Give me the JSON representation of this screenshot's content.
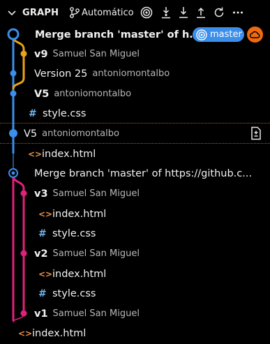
{
  "header": {
    "title": "GRAPH",
    "mode": "Automático",
    "icons": [
      "chevron-down-icon",
      "git-branch-icon",
      "target-icon",
      "fetch-icon",
      "pull-icon",
      "push-icon",
      "refresh-icon",
      "more-icon"
    ]
  },
  "commits": [
    {
      "message": "Merge branch 'master' of h...",
      "author": "",
      "bold": true,
      "badge": "master"
    },
    {
      "message": "v9",
      "author": "Samuel San Miguel",
      "bold": true
    },
    {
      "message": "Version 25",
      "author": "antoniomontalbo",
      "bold": false
    },
    {
      "message": "V5",
      "author": "antoniomontalbo",
      "bold": true
    },
    {
      "message": "V5",
      "author": "antoniomontalbo",
      "bold": false
    },
    {
      "message": "Merge branch 'master' of https://github.c...",
      "author": "",
      "bold": false
    },
    {
      "message": "v3",
      "author": "Samuel San Miguel",
      "bold": true
    },
    {
      "message": "v2",
      "author": "Samuel San Miguel",
      "bold": true
    },
    {
      "message": "v1",
      "author": "Samuel San Miguel",
      "bold": true
    }
  ],
  "files": [
    {
      "name": "style.css",
      "type": "css",
      "status": "M"
    },
    {
      "name": "index.html",
      "type": "html",
      "status": "M"
    },
    {
      "name": "index.html",
      "type": "html",
      "status": "M"
    },
    {
      "name": "style.css",
      "type": "css",
      "status": "M"
    },
    {
      "name": "index.html",
      "type": "html",
      "status": "M"
    },
    {
      "name": "style.css",
      "type": "css",
      "status": "M"
    },
    {
      "name": "index.html",
      "type": "html",
      "status": "A"
    }
  ],
  "badge": {
    "label": "master",
    "remote_icon": "cloud-icon"
  },
  "file_icons": {
    "html": "<>",
    "css": "#"
  },
  "colors": {
    "blue": "#3b8eea",
    "orange": "#e8a317",
    "pink": "#e0207a",
    "remote": "#f06a10",
    "html_icon": "#e8924a",
    "css_icon": "#6fb7f0"
  }
}
